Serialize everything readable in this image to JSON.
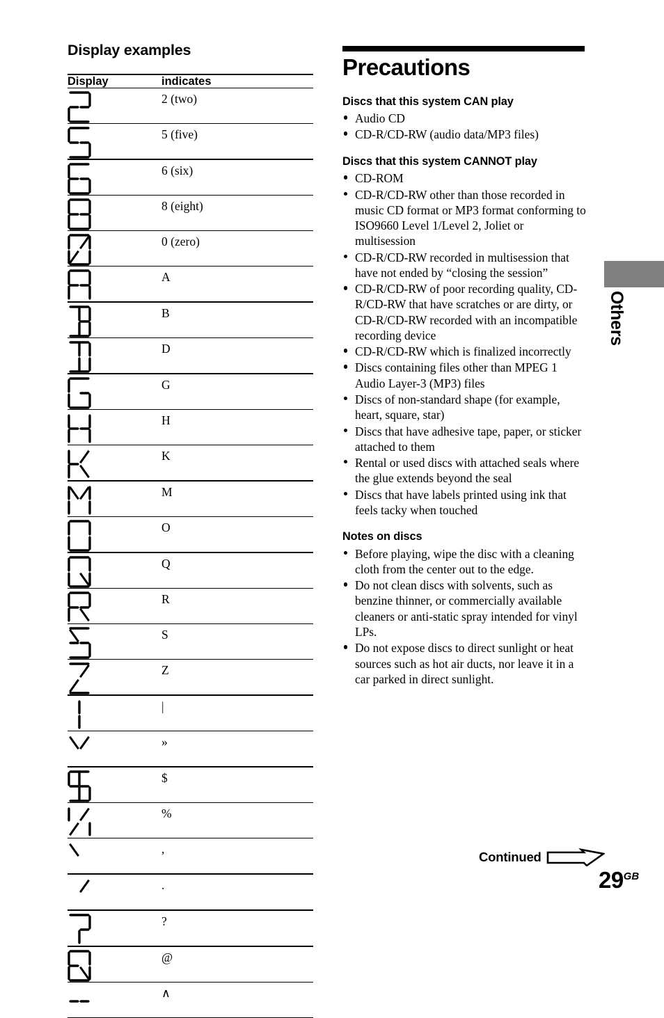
{
  "left": {
    "heading": "Display examples",
    "table": {
      "headers": [
        "Display",
        "indicates"
      ],
      "rows": [
        {
          "segments": "2",
          "indicates": "2 (two)",
          "thick_below": false
        },
        {
          "segments": "5",
          "indicates": "5 (five)",
          "thick_below": true
        },
        {
          "segments": "6",
          "indicates": "6 (six)",
          "thick_below": false
        },
        {
          "segments": "8",
          "indicates": "8 (eight)",
          "thick_below": false
        },
        {
          "segments": "0",
          "indicates": "0 (zero)",
          "thick_below": false
        },
        {
          "segments": "A",
          "indicates": "A",
          "thick_below": true
        },
        {
          "segments": "B",
          "indicates": "B",
          "thick_below": false
        },
        {
          "segments": "D",
          "indicates": "D",
          "thick_below": true
        },
        {
          "segments": "G",
          "indicates": "G",
          "thick_below": false
        },
        {
          "segments": "H",
          "indicates": "H",
          "thick_below": false
        },
        {
          "segments": "K",
          "indicates": "K",
          "thick_below": true
        },
        {
          "segments": "M",
          "indicates": "M",
          "thick_below": false
        },
        {
          "segments": "O",
          "indicates": "O",
          "thick_below": true
        },
        {
          "segments": "Q",
          "indicates": "Q",
          "thick_below": false
        },
        {
          "segments": "R",
          "indicates": "R",
          "thick_below": false
        },
        {
          "segments": "S",
          "indicates": "S",
          "thick_below": false
        },
        {
          "segments": "Z",
          "indicates": "Z",
          "thick_below": true
        },
        {
          "segments": "|",
          "indicates": "|",
          "thick_below": false
        },
        {
          "segments": "\"",
          "indicates": "»",
          "thick_below": true
        },
        {
          "segments": "$",
          "indicates": "$",
          "thick_below": false
        },
        {
          "segments": "%",
          "indicates": "%",
          "thick_below": false
        },
        {
          "segments": "'",
          "indicates": ",",
          "thick_below": true
        },
        {
          "segments": "`",
          "indicates": ".",
          "thick_below": true
        },
        {
          "segments": "?",
          "indicates": "?",
          "thick_below": true
        },
        {
          "segments": "@",
          "indicates": "@",
          "thick_below": false
        },
        {
          "segments": "-",
          "indicates": "∧",
          "thick_below": false
        }
      ]
    }
  },
  "right": {
    "title": "Precautions",
    "sections": [
      {
        "heading": "Discs that this system CAN play",
        "bullets": [
          "Audio CD",
          "CD-R/CD-RW (audio data/MP3 files)"
        ]
      },
      {
        "heading": "Discs that this system CANNOT play",
        "bullets": [
          "CD-ROM",
          "CD-R/CD-RW other than those recorded in music CD format or MP3 format conforming to ISO9660 Level 1/Level 2, Joliet or multisession",
          "CD-R/CD-RW recorded in multisession that have not ended by “closing the session”",
          "CD-R/CD-RW of poor recording quality, CD-R/CD-RW that have scratches or are dirty, or CD-R/CD-RW recorded with an incompatible recording device",
          "CD-R/CD-RW which is finalized incorrectly",
          "Discs containing files other than MPEG 1 Audio Layer-3 (MP3) files",
          "Discs of non-standard shape (for example, heart, square, star)",
          "Discs that have adhesive tape, paper, or sticker attached to them",
          "Rental or used discs with attached seals where the glue extends beyond the seal",
          "Discs that have labels printed using ink that feels tacky when touched"
        ]
      },
      {
        "heading": "Notes on discs",
        "bullets": [
          "Before playing, wipe the disc with a cleaning cloth from the center out to the edge.",
          "Do not clean discs with solvents, such as benzine thinner, or commercially available cleaners or anti-static spray intended for vinyl LPs.",
          "Do not expose discs to direct sunlight or heat sources such as hot air ducts, nor leave it in a car parked in direct sunlight."
        ]
      }
    ]
  },
  "side_tab": {
    "label": "Others",
    "color": "#808080"
  },
  "footer": {
    "continued_label": "Continued",
    "page_number": "29",
    "page_suffix": "GB"
  }
}
